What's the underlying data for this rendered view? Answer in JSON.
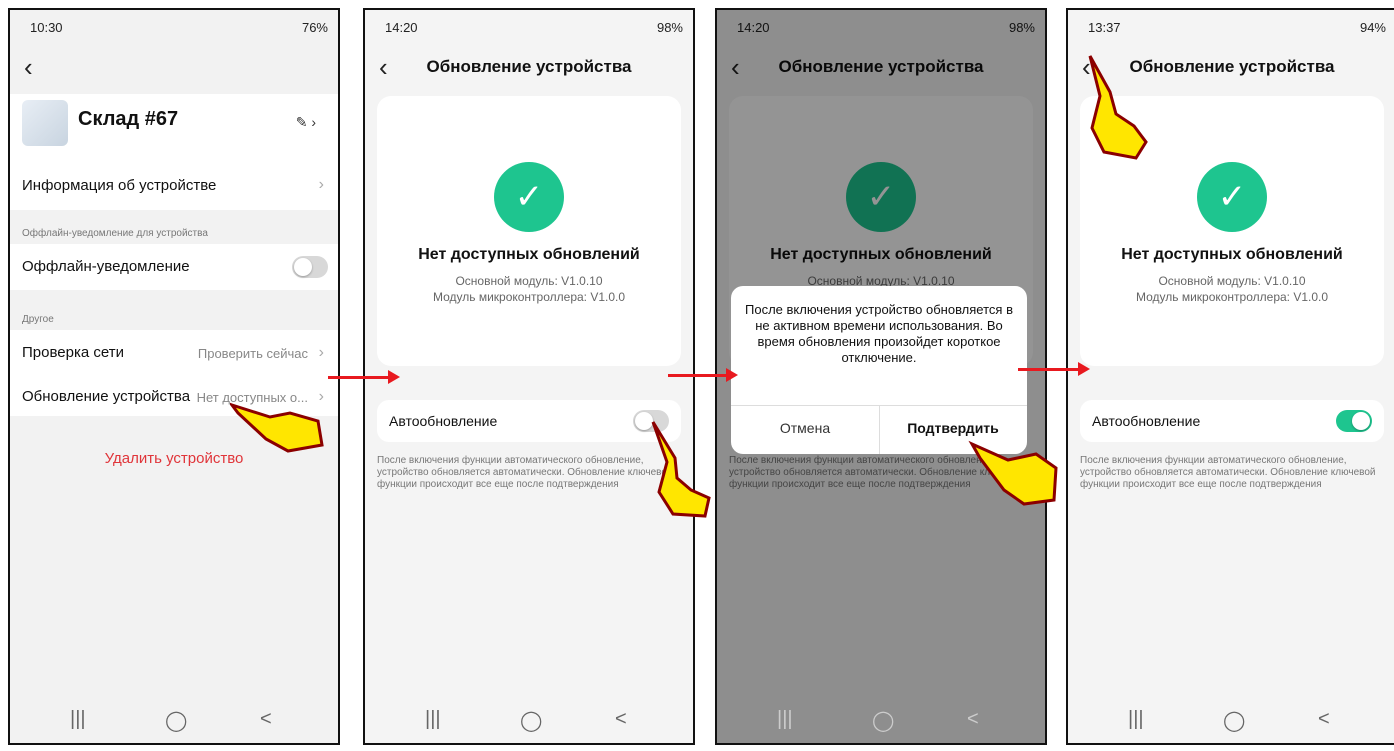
{
  "phone1": {
    "status": {
      "time": "10:30",
      "battery": "76%"
    },
    "device_name": "Склад #67",
    "device_info_label": "Информация об устройстве",
    "offline_section": "Оффлайн-уведомление для устройства",
    "offline_label": "Оффлайн-уведомление",
    "other_section": "Другое",
    "network_label": "Проверка сети",
    "network_value": "Проверить сейчас",
    "update_label": "Обновление устройства",
    "update_value": "Нет доступных о...",
    "delete_label": "Удалить устройство"
  },
  "phone2": {
    "status": {
      "time": "14:20",
      "battery": "98%"
    },
    "title": "Обновление устройства",
    "no_updates": "Нет доступных обновлений",
    "main_module": "Основной модуль: V1.0.10",
    "mcu_module": "Модуль микроконтроллера: V1.0.0",
    "auto_update_label": "Автообновление",
    "auto_update_on": false,
    "note": "После включения функции автоматического обновление, устройство обновляется автоматически. Обновление ключевой функции происходит все еще после подтверждения"
  },
  "phone3": {
    "status": {
      "time": "14:20",
      "battery": "98%"
    },
    "title": "Обновление устройства",
    "no_updates": "Нет доступных обновлений",
    "main_module": "Основной модуль: V1.0.10",
    "dialog_text": "После включения устройство обновляется в не активном времени использования. Во время обновления произойдет короткое отключение.",
    "cancel": "Отмена",
    "confirm": "Подтвердить",
    "note": "После включения функции автоматического обновление, устройство обновляется автоматически. Обновление ключевой функции происходит все еще после подтверждения"
  },
  "phone4": {
    "status": {
      "time": "13:37",
      "battery": "94%"
    },
    "title": "Обновление устройства",
    "no_updates": "Нет доступных обновлений",
    "main_module": "Основной модуль: V1.0.10",
    "mcu_module": "Модуль микроконтроллера: V1.0.0",
    "auto_update_label": "Автообновление",
    "auto_update_on": true,
    "note": "После включения функции автоматического обновление, устройство обновляется автоматически. Обновление ключевой функции происходит все еще после подтверждения"
  },
  "nav": {
    "menu": "|||",
    "home": "◯",
    "back": "<"
  },
  "icons": {
    "back": "chevron-left-icon",
    "check": "check-circle-icon",
    "edit": "edit-icon",
    "chevron": "chevron-right-icon"
  },
  "colors": {
    "accent": "#1ec58f",
    "danger": "#e0353a",
    "arrow": "#e8191f"
  }
}
